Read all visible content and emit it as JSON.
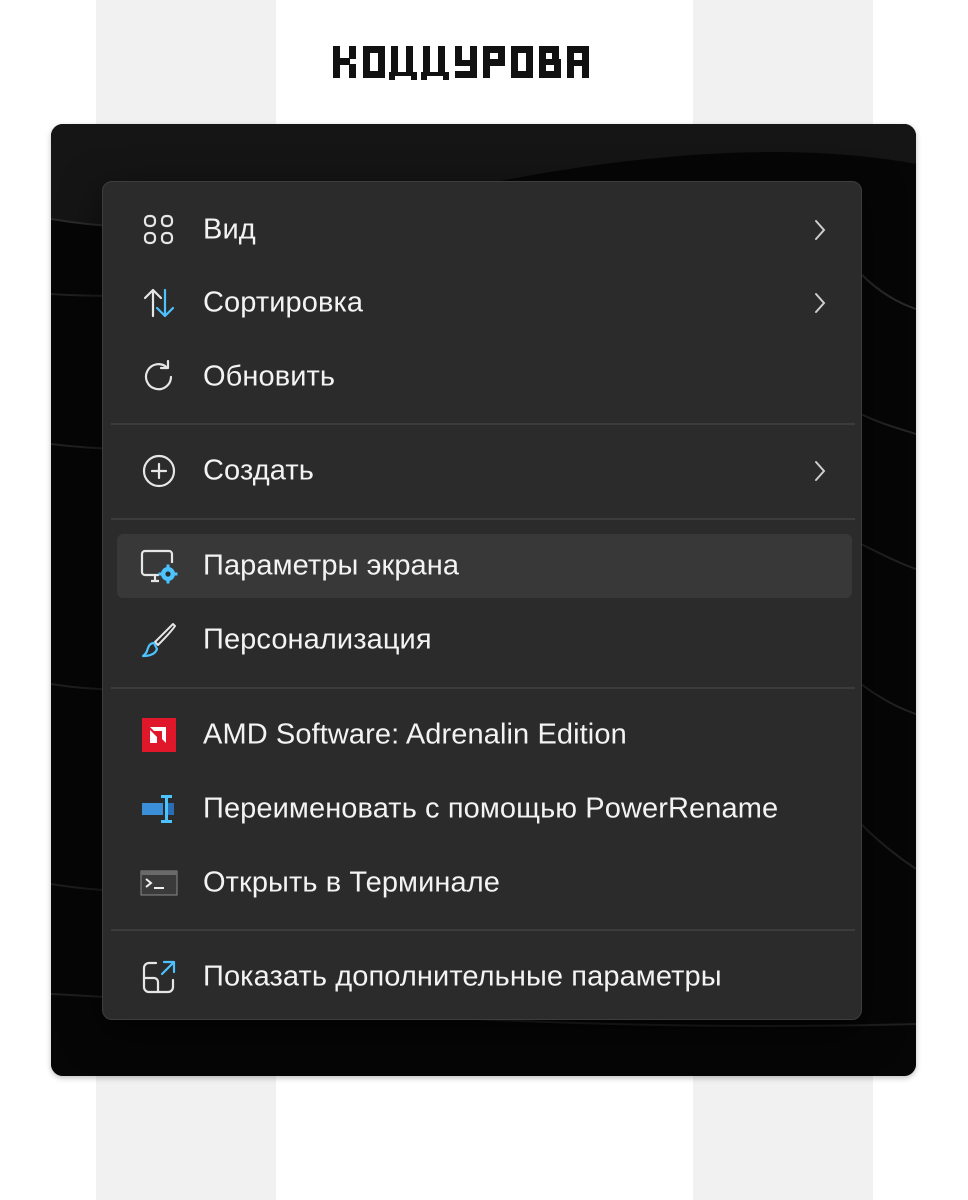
{
  "brand": {
    "logo_text": "КОДДУРОВА"
  },
  "menu": {
    "items": [
      {
        "label": "Вид",
        "icon": "view-icon",
        "submenu": true
      },
      {
        "label": "Сортировка",
        "icon": "sort-icon",
        "submenu": true
      },
      {
        "label": "Обновить",
        "icon": "refresh-icon",
        "submenu": false
      },
      {
        "label": "Создать",
        "icon": "new-icon",
        "submenu": true
      },
      {
        "label": "Параметры экрана",
        "icon": "display-settings-icon",
        "submenu": false,
        "highlighted": true
      },
      {
        "label": "Персонализация",
        "icon": "brush-icon",
        "submenu": false
      },
      {
        "label": "AMD Software: Adrenalin Edition",
        "icon": "amd-icon",
        "submenu": false
      },
      {
        "label": "Переименовать с помощью PowerRename",
        "icon": "powerrename-icon",
        "submenu": false
      },
      {
        "label": "Открыть в Терминале",
        "icon": "terminal-icon",
        "submenu": false
      },
      {
        "label": "Показать дополнительные параметры",
        "icon": "more-options-icon",
        "submenu": false
      }
    ]
  },
  "colors": {
    "menu_bg": "#2b2b2b",
    "highlight": "#383838",
    "text": "#f3f3f3",
    "accent_blue": "#4cc2ff",
    "amd_red": "#e0162b"
  }
}
